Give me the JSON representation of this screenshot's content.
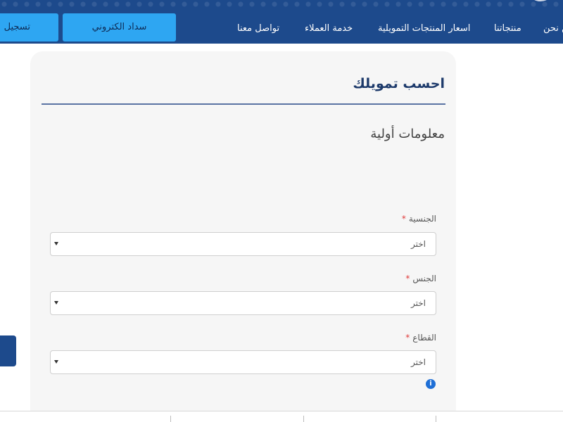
{
  "header": {
    "nav": [
      {
        "label": "من نحن"
      },
      {
        "label": "منتجاتنا"
      },
      {
        "label": "اسعار المنتجات التمويلية"
      },
      {
        "label": "خدمة العملاء"
      },
      {
        "label": "تواصل معنا"
      }
    ],
    "pay_label": "سداد الكتروني",
    "register_label": "تسجيل"
  },
  "card": {
    "title": "احسب تمويلك",
    "section_title": "معلومات أولية",
    "required_mark": "*",
    "fields": [
      {
        "label": "الجنسية",
        "value": "اختر"
      },
      {
        "label": "الجنس",
        "value": "اختر"
      },
      {
        "label": "القطاع",
        "value": "اختر"
      }
    ],
    "info_icon": "info-icon"
  },
  "colors": {
    "header_bg": "#1d4a8c",
    "button_bg": "#2ea6f2",
    "title_color": "#1d3a6b",
    "required": "#e03b3b"
  }
}
